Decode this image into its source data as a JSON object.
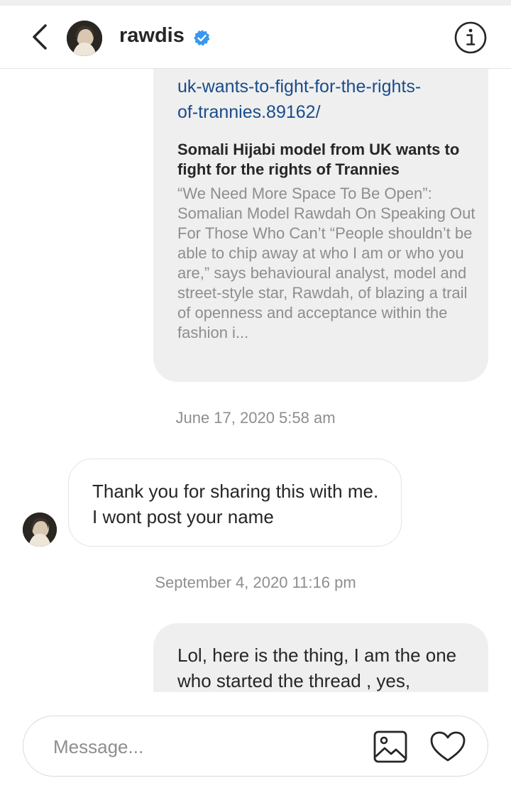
{
  "header": {
    "username": "rawdis",
    "verified": true
  },
  "messages": {
    "link_card": {
      "url_line_1": "uk-wants-to-fight-for-the-rights-",
      "url_line_2": "of-trannies.89162/",
      "title": "Somali Hijabi model from UK wants to fight for the rights of Trannies",
      "description": "“We Need More Space To Be Open”: Somalian Model Rawdah On Speaking Out For Those Who Can’t “People shouldn’t be able to chip away at who I am or who you are,” says behavioural analyst, model and street-style star, Rawdah, of blazing a trail of openness and acceptance within the fashion i..."
    },
    "timestamp_1": "June 17, 2020 5:58 am",
    "incoming_1": "Thank you for sharing this with me. I wont post your name",
    "timestamp_2": "September 4, 2020 11:16 pm",
    "outgoing_1": "Lol, here is the thing, I am the one who started the thread , yes,"
  },
  "composer": {
    "placeholder": "Message..."
  },
  "colors": {
    "link": "#1a4c8b",
    "verified": "#3897f0",
    "bubble": "#efefef",
    "muted": "#8e8e8e"
  },
  "icons": [
    "chevron-left-icon",
    "verified-badge-icon",
    "info-icon",
    "image-icon",
    "heart-icon"
  ]
}
